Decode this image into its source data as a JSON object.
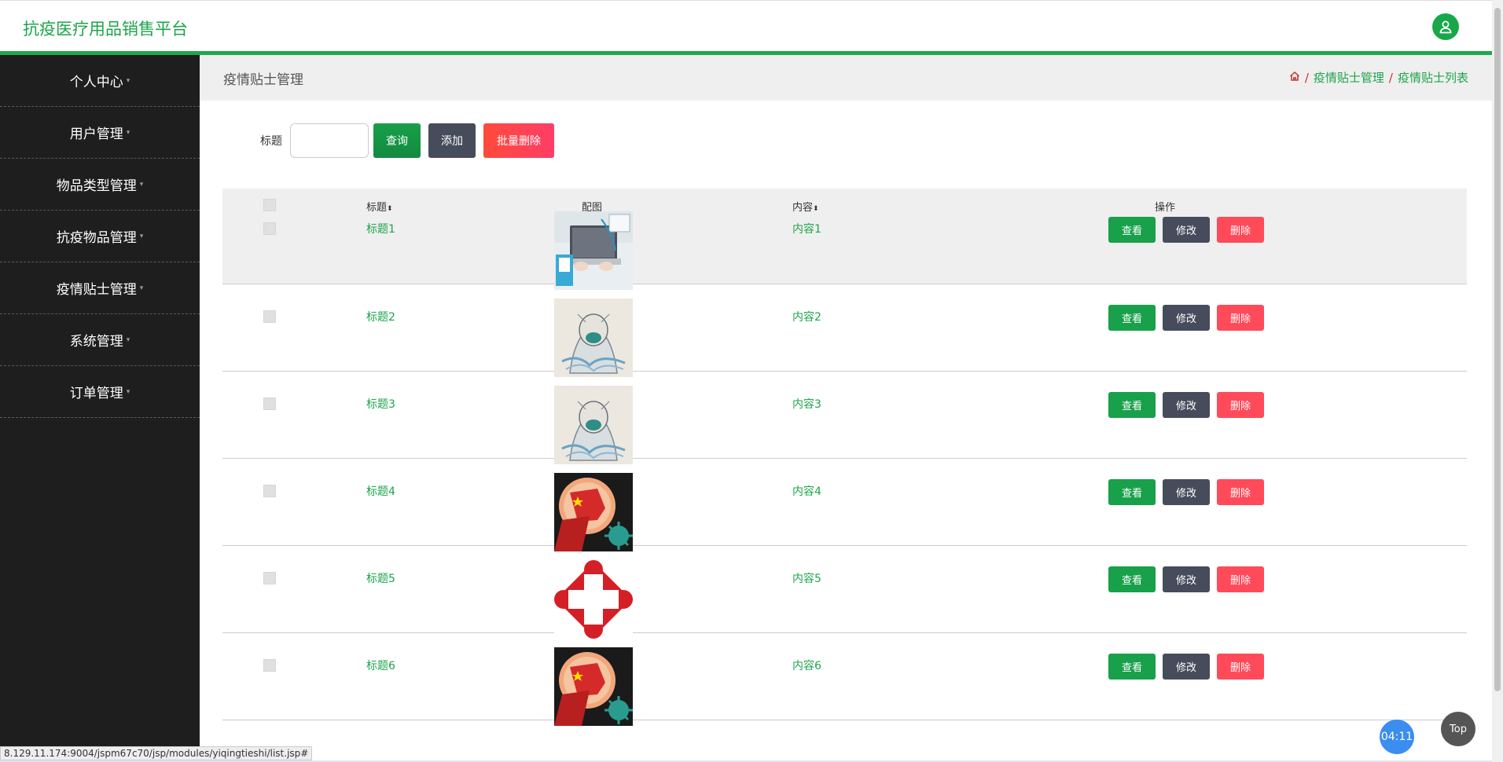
{
  "header": {
    "title": "抗疫医疗用品销售平台",
    "user_icon": "user-icon",
    "accent": "#1fa84f"
  },
  "sidebar": {
    "items": [
      {
        "label": "个人中心"
      },
      {
        "label": "用户管理"
      },
      {
        "label": "物品类型管理"
      },
      {
        "label": "抗疫物品管理"
      },
      {
        "label": "疫情贴士管理"
      },
      {
        "label": "系统管理"
      },
      {
        "label": "订单管理"
      }
    ]
  },
  "page": {
    "title": "疫情贴士管理",
    "breadcrumb": [
      "疫情贴士管理",
      "疫情贴士列表"
    ]
  },
  "search": {
    "label": "标题",
    "value": "",
    "query_label": "查询",
    "add_label": "添加",
    "batch_delete_label": "批量删除"
  },
  "table": {
    "headers": {
      "title": "标题",
      "image": "配图",
      "content": "内容",
      "ops": "操作"
    },
    "sort_icon": "sort-icon",
    "ops": {
      "view": "查看",
      "edit": "修改",
      "delete": "删除"
    },
    "rows": [
      {
        "title": "标题1",
        "content": "内容1",
        "image": "doctor-laptop-photo"
      },
      {
        "title": "标题2",
        "content": "内容2",
        "image": "masked-figure-illustration"
      },
      {
        "title": "标题3",
        "content": "内容3",
        "image": "masked-figure-illustration"
      },
      {
        "title": "标题4",
        "content": "内容4",
        "image": "fist-vs-virus-poster"
      },
      {
        "title": "标题5",
        "content": "内容5",
        "image": "red-cross-emblem"
      },
      {
        "title": "标题6",
        "content": "内容6",
        "image": "fist-vs-virus-poster"
      }
    ]
  },
  "status_url": "8.129.11.174:9004/jspm67c70/jsp/modules/yiqingtieshi/list.jsp#",
  "timer": "04:11",
  "top_label": "Top"
}
